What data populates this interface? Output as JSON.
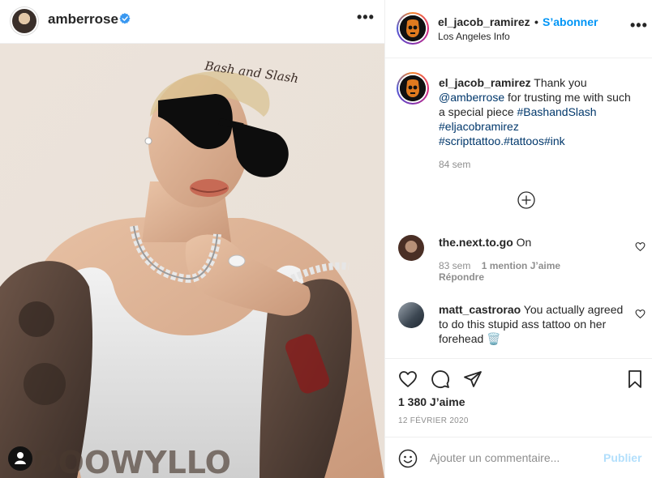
{
  "left_header": {
    "username": "amberrose",
    "verified_icon": "verified-badge-icon",
    "more_label": "•••"
  },
  "right_header": {
    "username": "el_jacob_ramirez",
    "separator": "•",
    "follow_label": "S’abonner",
    "location": "Los Angeles Info",
    "more_label": "•••"
  },
  "caption": {
    "username": "el_jacob_ramirez",
    "text_1": " Thank you ",
    "mention": "@amberrose",
    "text_2": " for trusting me with such a special piece ",
    "hashtag_1": "#BashandSlash",
    "hashtag_2": "#eljacobramirez",
    "hashtag_3": "#scripttattoo.#tattoos#ink",
    "time": "84 sem"
  },
  "comments": [
    {
      "username": "the.next.to.go",
      "text": "On",
      "time": "83 sem",
      "likes": "1 mention J’aime",
      "reply": "Répondre"
    },
    {
      "username": "matt_castrorao",
      "text": "You actually agreed to do this stupid ass tattoo on her forehead",
      "emoji": "🗑️"
    }
  ],
  "actions": {
    "icons": [
      "heart-icon",
      "comment-icon",
      "share-icon",
      "bookmark-icon"
    ]
  },
  "likes": "1 380 J’aime",
  "date": "12 FÉVRIER 2020",
  "comment_bar": {
    "placeholder": "Ajouter un commentaire...",
    "publish_label": "Publier"
  },
  "photo": {
    "forehead_tattoo": "Bash and Slash"
  },
  "colors": {
    "link": "#00376b",
    "follow": "#0095f6",
    "publish_disabled": "#b2dffc",
    "muted": "#8e8e8e"
  }
}
